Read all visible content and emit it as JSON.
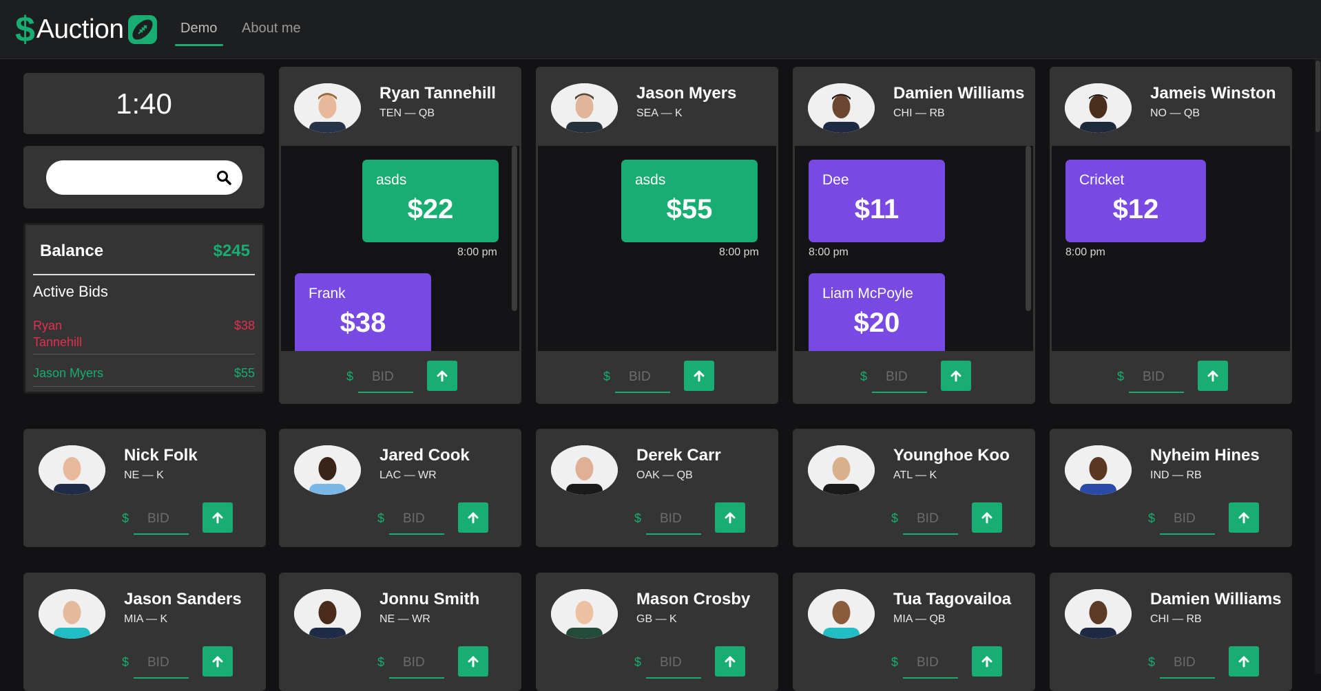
{
  "nav": {
    "logo_dollar": "$",
    "logo_text": "Auction",
    "links": [
      "Demo",
      "About me"
    ]
  },
  "timer": "1:40",
  "search": {
    "placeholder": "",
    "value": ""
  },
  "balance": {
    "label": "Balance",
    "value": "$245",
    "active_bids_title": "Active Bids",
    "bids": [
      {
        "name": "Ryan Tannehill",
        "amount": "$38",
        "status": "outbid"
      },
      {
        "name": "Jason Myers",
        "amount": "$55",
        "status": "winning"
      }
    ]
  },
  "bid_form": {
    "dollar": "$",
    "placeholder": "BID"
  },
  "active_cards": [
    {
      "name": "Ryan Tannehill",
      "meta": "TEN — QB",
      "bids": [
        {
          "bidder": "asds",
          "amount": "$22",
          "time": "8:00 pm",
          "mine": true
        },
        {
          "bidder": "Frank",
          "amount": "$38",
          "time": "",
          "mine": false
        }
      ]
    },
    {
      "name": "Jason Myers",
      "meta": "SEA — K",
      "bids": [
        {
          "bidder": "asds",
          "amount": "$55",
          "time": "8:00 pm",
          "mine": true
        }
      ]
    },
    {
      "name": "Damien Williams",
      "meta": "CHI — RB",
      "bids": [
        {
          "bidder": "Dee",
          "amount": "$11",
          "time": "8:00 pm",
          "mine": false
        },
        {
          "bidder": "Liam McPoyle",
          "amount": "$20",
          "time": "",
          "mine": false
        }
      ]
    },
    {
      "name": "Jameis Winston",
      "meta": "NO — QB",
      "bids": [
        {
          "bidder": "Cricket",
          "amount": "$12",
          "time": "8:00 pm",
          "mine": false
        }
      ]
    }
  ],
  "players": [
    {
      "name": "Nick Folk",
      "meta": "NE — K"
    },
    {
      "name": "Jared Cook",
      "meta": "LAC — WR"
    },
    {
      "name": "Derek Carr",
      "meta": "OAK — QB"
    },
    {
      "name": "Younghoe Koo",
      "meta": "ATL — K"
    },
    {
      "name": "Nyheim Hines",
      "meta": "IND — RB"
    },
    {
      "name": "Jason Sanders",
      "meta": "MIA — K"
    },
    {
      "name": "Jonnu Smith",
      "meta": "NE — WR"
    },
    {
      "name": "Mason Crosby",
      "meta": "GB — K"
    },
    {
      "name": "Tua Tagovailoa",
      "meta": "MIA — QB"
    },
    {
      "name": "Damien Williams",
      "meta": "CHI — RB"
    }
  ],
  "colors": {
    "accent": "#18ad72",
    "outbid": "#e3304e",
    "other_bidder": "#7849e3",
    "card": "#343434",
    "background": "#121214"
  }
}
